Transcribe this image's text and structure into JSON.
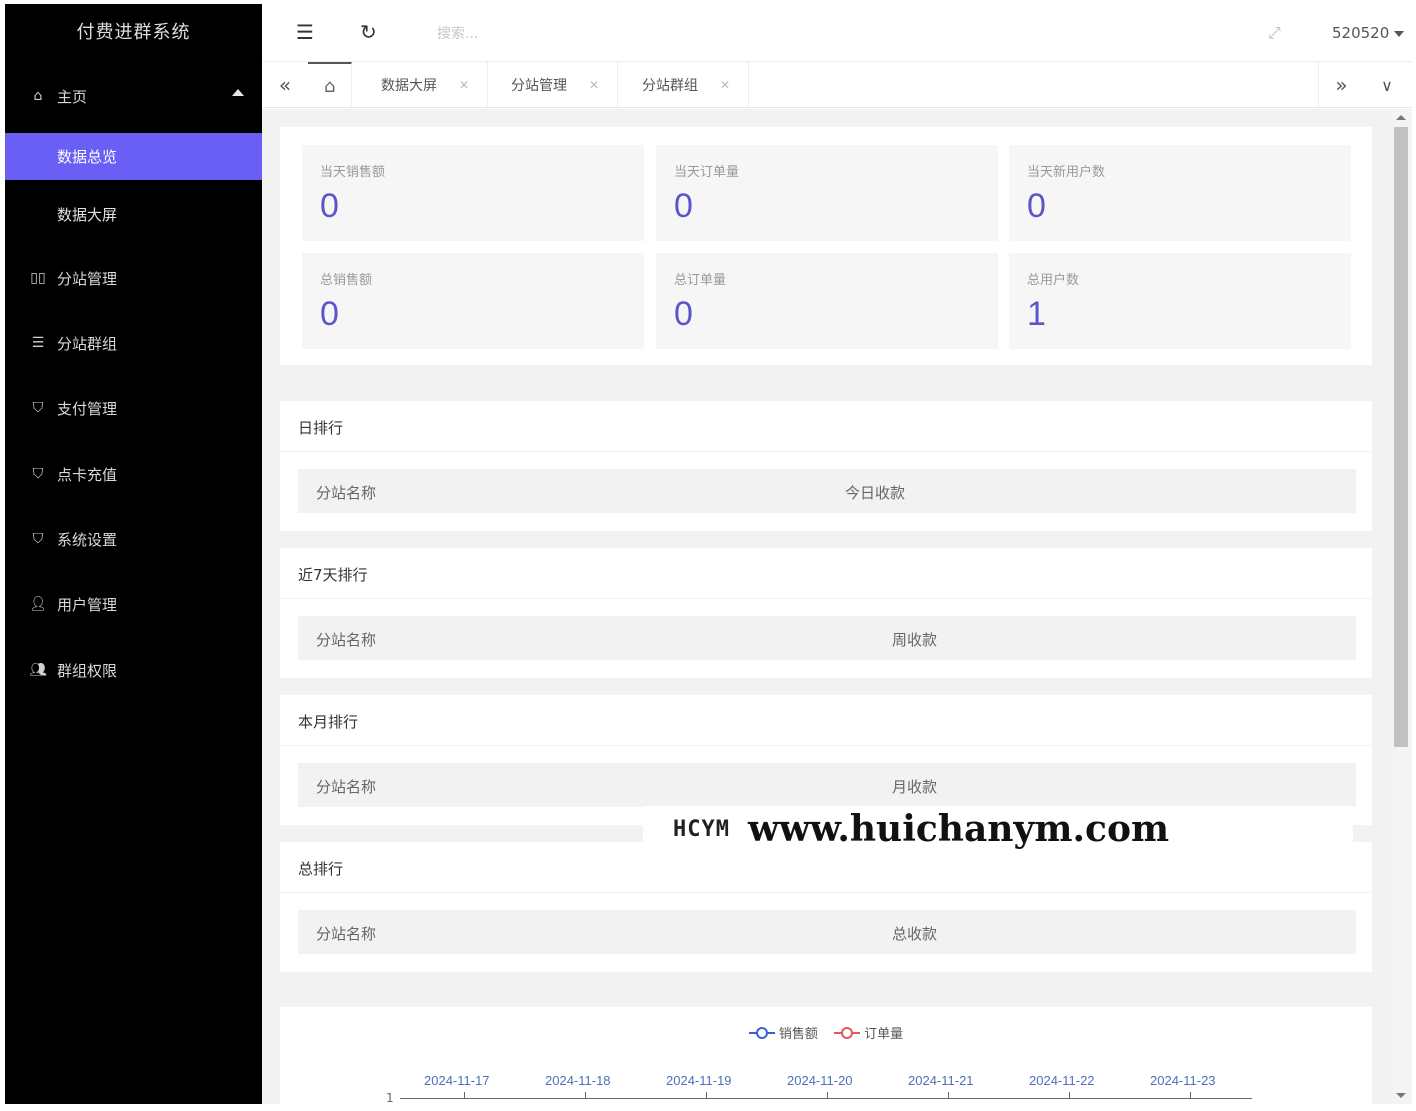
{
  "app": {
    "title": "付费进群系统"
  },
  "sidebar": {
    "home": {
      "label": "主页",
      "icon": "home-icon"
    },
    "sub_items": [
      {
        "label": "数据总览",
        "active": true
      },
      {
        "label": "数据大屏",
        "active": false
      }
    ],
    "items": [
      {
        "label": "分站管理",
        "icon": "columns-icon"
      },
      {
        "label": "分站群组",
        "icon": "list-icon"
      },
      {
        "label": "支付管理",
        "icon": "shield-check-icon"
      },
      {
        "label": "点卡充值",
        "icon": "shield-check-icon"
      },
      {
        "label": "系统设置",
        "icon": "shield-check-icon"
      },
      {
        "label": "用户管理",
        "icon": "user-icon"
      },
      {
        "label": "群组权限",
        "icon": "users-icon"
      }
    ]
  },
  "header": {
    "search_placeholder": "搜索...",
    "username": "520520"
  },
  "tabs": [
    {
      "label": "数据大屏"
    },
    {
      "label": "分站管理"
    },
    {
      "label": "分站群组"
    }
  ],
  "stats": [
    {
      "label": "当天销售额",
      "value": "0"
    },
    {
      "label": "当天订单量",
      "value": "0"
    },
    {
      "label": "当天新用户数",
      "value": "0"
    },
    {
      "label": "总销售额",
      "value": "0"
    },
    {
      "label": "总订单量",
      "value": "0"
    },
    {
      "label": "总用户数",
      "value": "1"
    }
  ],
  "rankings": [
    {
      "title": "日排行",
      "col1": "分站名称",
      "col2": "今日收款"
    },
    {
      "title": "近7天排行",
      "col1": "分站名称",
      "col2": "周收款"
    },
    {
      "title": "本月排行",
      "col1": "分站名称",
      "col2": "月收款"
    },
    {
      "title": "总排行",
      "col1": "分站名称",
      "col2": "总收款"
    }
  ],
  "chart_data": {
    "type": "line",
    "x": [
      "2024-11-17",
      "2024-11-18",
      "2024-11-19",
      "2024-11-20",
      "2024-11-21",
      "2024-11-22",
      "2024-11-23"
    ],
    "series": [
      {
        "name": "销售额",
        "color": "#3b5fd9",
        "values": []
      },
      {
        "name": "订单量",
        "color": "#e05a5a",
        "values": []
      }
    ],
    "y_tick_visible": "1",
    "legend": "top-center"
  },
  "watermark": {
    "logo": "HCYM",
    "url": "www.huichanym.com"
  },
  "colors": {
    "accent": "#6a5ff5",
    "sidebar_bg": "#000000",
    "stat_value": "#5b55c9"
  }
}
